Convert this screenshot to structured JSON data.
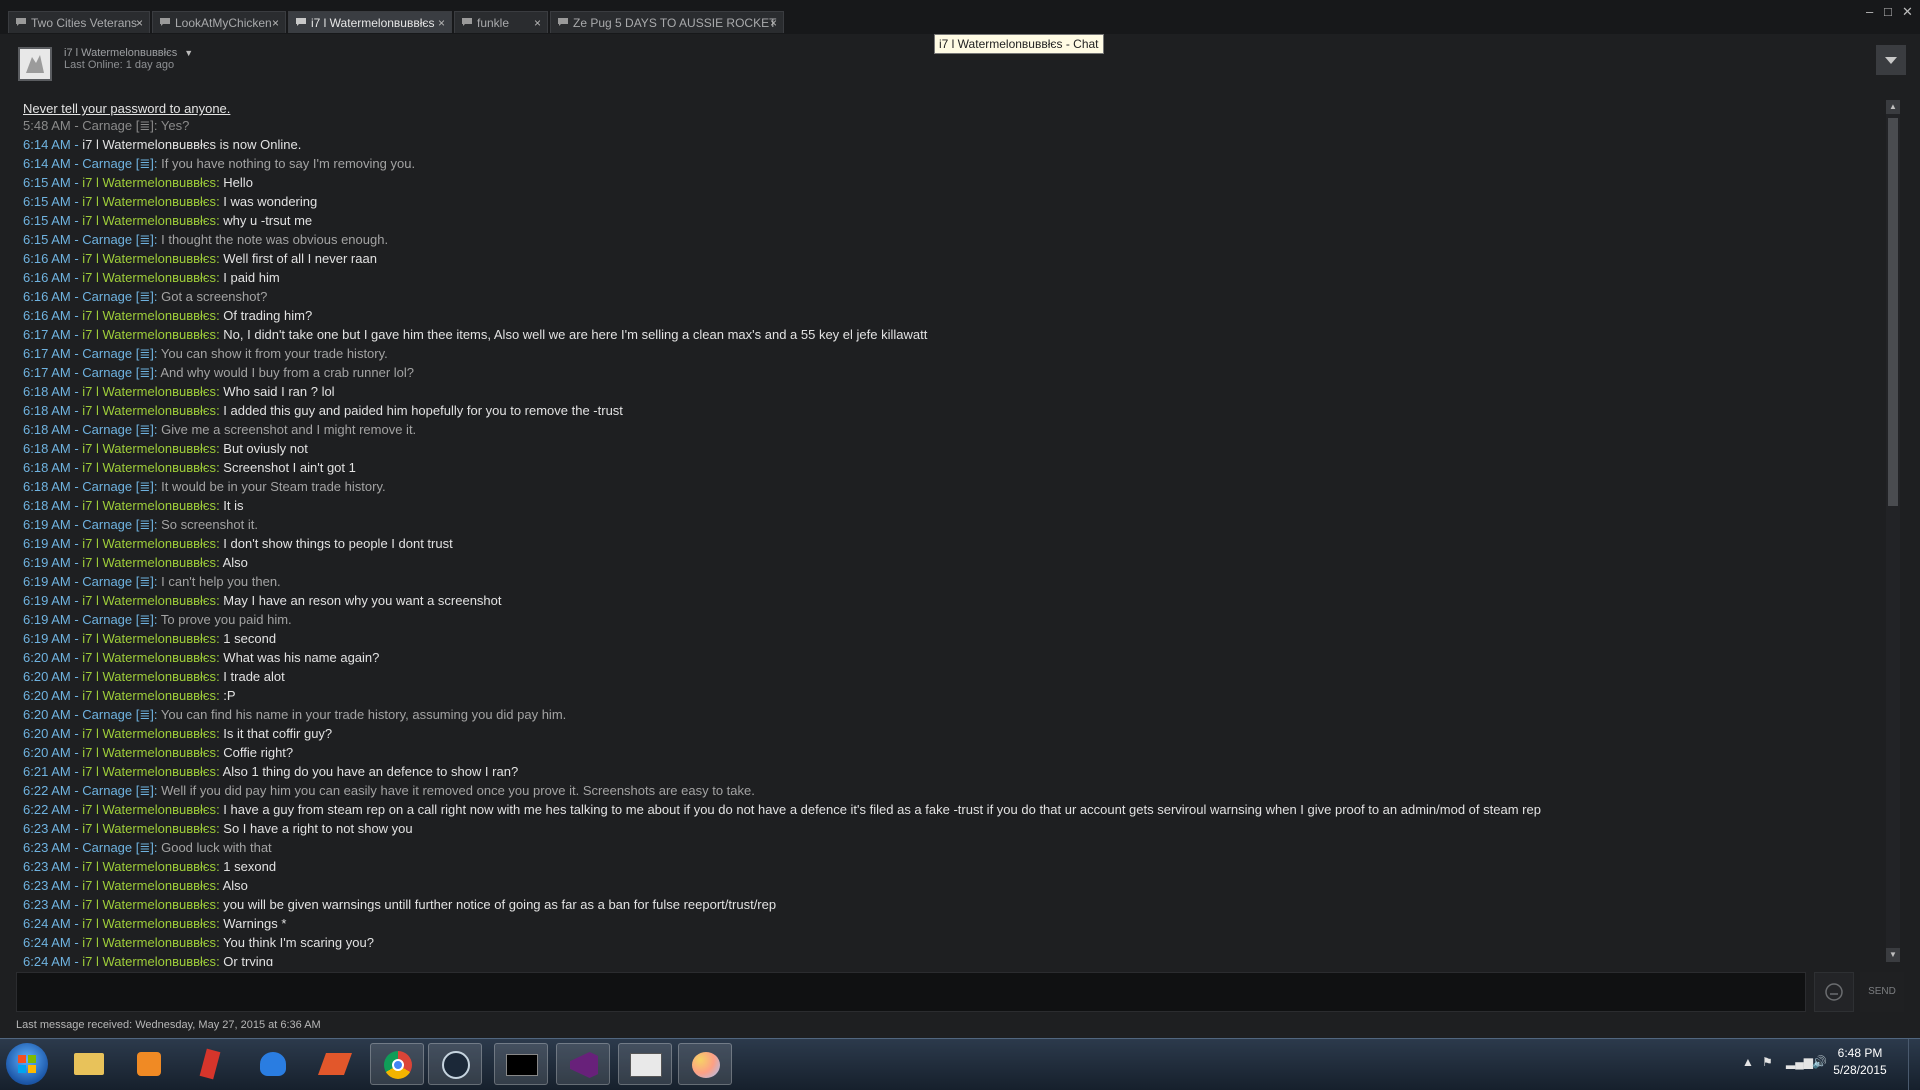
{
  "window": {
    "tabs": [
      {
        "label": "Two Cities Veterans"
      },
      {
        "label": "LookAtMyChicken"
      },
      {
        "label": "i7 l Watermelonвuввłєs"
      },
      {
        "label": "funkle"
      },
      {
        "label": "Ze Pug 5 DAYS TO AUSSIE ROCKET"
      }
    ],
    "tooltip": "i7 l Watermelonвuввłєs - Chat",
    "controls": {
      "minimize": "–",
      "maximize": "□",
      "close": "✕"
    }
  },
  "header": {
    "name": "i7 l Watermelonвuввłєs",
    "last_online": "Last Online: 1 day ago"
  },
  "chat": {
    "warning": "Never tell your password to anyone.",
    "messages": [
      {
        "time": "5:48 AM",
        "name": "Carnage [≣]",
        "msg": "Yes?",
        "who": "c",
        "old": true
      },
      {
        "time": "6:14 AM",
        "name": "",
        "msg": "i7 l Watermelonвuввłєs is now Online.",
        "who": "s"
      },
      {
        "time": "6:14 AM",
        "name": "Carnage [≣]",
        "msg": "If you have nothing to say I'm removing you.",
        "who": "c"
      },
      {
        "time": "6:15 AM",
        "name": "i7 l Watermelonвuввłєs",
        "msg": "Hello",
        "who": "w"
      },
      {
        "time": "6:15 AM",
        "name": "i7 l Watermelonвuввłєs",
        "msg": "I was wondering",
        "who": "w"
      },
      {
        "time": "6:15 AM",
        "name": "i7 l Watermelonвuввłєs",
        "msg": "why u -trsut me",
        "who": "w"
      },
      {
        "time": "6:15 AM",
        "name": "Carnage [≣]",
        "msg": "I thought the note was obvious enough.",
        "who": "c"
      },
      {
        "time": "6:16 AM",
        "name": "i7 l Watermelonвuввłєs",
        "msg": "Well first of all I never raan",
        "who": "w"
      },
      {
        "time": "6:16 AM",
        "name": "i7 l Watermelonвuввłєs",
        "msg": "I paid him",
        "who": "w"
      },
      {
        "time": "6:16 AM",
        "name": "Carnage [≣]",
        "msg": "Got a screenshot?",
        "who": "c"
      },
      {
        "time": "6:16 AM",
        "name": "i7 l Watermelonвuввłєs",
        "msg": "Of trading him?",
        "who": "w"
      },
      {
        "time": "6:17 AM",
        "name": "i7 l Watermelonвuввłєs",
        "msg": "No, I didn't take one but I gave him thee items, Also well we are here I'm selling a clean max's and a 55 key el jefe killawatt",
        "who": "w"
      },
      {
        "time": "6:17 AM",
        "name": "Carnage [≣]",
        "msg": "You can show it from your trade history.",
        "who": "c"
      },
      {
        "time": "6:17 AM",
        "name": "Carnage [≣]",
        "msg": "And why would I buy from a crab runner lol?",
        "who": "c"
      },
      {
        "time": "6:18 AM",
        "name": "i7 l Watermelonвuввłєs",
        "msg": "Who said I ran ? lol",
        "who": "w"
      },
      {
        "time": "6:18 AM",
        "name": "i7 l Watermelonвuввłєs",
        "msg": "I added this guy and paided him hopefully for you to remove the -trust",
        "who": "w"
      },
      {
        "time": "6:18 AM",
        "name": "Carnage [≣]",
        "msg": "Give me a screenshot and I might remove it.",
        "who": "c"
      },
      {
        "time": "6:18 AM",
        "name": "i7 l Watermelonвuввłєs",
        "msg": "But oviusly not",
        "who": "w"
      },
      {
        "time": "6:18 AM",
        "name": "i7 l Watermelonвuввłєs",
        "msg": "Screenshot I ain't got 1",
        "who": "w"
      },
      {
        "time": "6:18 AM",
        "name": "Carnage [≣]",
        "msg": "It would be in your Steam trade history.",
        "who": "c"
      },
      {
        "time": "6:18 AM",
        "name": "i7 l Watermelonвuввłєs",
        "msg": "It is",
        "who": "w"
      },
      {
        "time": "6:19 AM",
        "name": "Carnage [≣]",
        "msg": "So screenshot it.",
        "who": "c"
      },
      {
        "time": "6:19 AM",
        "name": "i7 l Watermelonвuввłєs",
        "msg": "I don't show things to people I dont trust",
        "who": "w"
      },
      {
        "time": "6:19 AM",
        "name": "i7 l Watermelonвuввłєs",
        "msg": "Also",
        "who": "w"
      },
      {
        "time": "6:19 AM",
        "name": "Carnage [≣]",
        "msg": "I can't help you then.",
        "who": "c"
      },
      {
        "time": "6:19 AM",
        "name": "i7 l Watermelonвuввłєs",
        "msg": "May I have an reson why  you want a screenshot",
        "who": "w"
      },
      {
        "time": "6:19 AM",
        "name": "Carnage [≣]",
        "msg": "To prove you paid him.",
        "who": "c"
      },
      {
        "time": "6:19 AM",
        "name": "i7 l Watermelonвuввłєs",
        "msg": "1 second",
        "who": "w"
      },
      {
        "time": "6:20 AM",
        "name": "i7 l Watermelonвuввłєs",
        "msg": "What was his name again?",
        "who": "w"
      },
      {
        "time": "6:20 AM",
        "name": "i7 l Watermelonвuввłєs",
        "msg": "I trade alot",
        "who": "w"
      },
      {
        "time": "6:20 AM",
        "name": "i7 l Watermelonвuввłєs",
        "msg": ":P",
        "who": "w"
      },
      {
        "time": "6:20 AM",
        "name": "Carnage [≣]",
        "msg": "You can find his name in your trade history, assuming you did pay him.",
        "who": "c"
      },
      {
        "time": "6:20 AM",
        "name": "i7 l Watermelonвuввłєs",
        "msg": "Is it that coffir guy?",
        "who": "w"
      },
      {
        "time": "6:20 AM",
        "name": "i7 l Watermelonвuввłєs",
        "msg": "Coffie right?",
        "who": "w"
      },
      {
        "time": "6:21 AM",
        "name": "i7 l Watermelonвuввłєs",
        "msg": "Also 1 thing do you have an defence to show I ran?",
        "who": "w"
      },
      {
        "time": "6:22 AM",
        "name": "Carnage [≣]",
        "msg": "Well if you did pay him you can easily have it removed once you prove it. Screenshots are easy to take.",
        "who": "c"
      },
      {
        "time": "6:22 AM",
        "name": "i7 l Watermelonвuввłєs",
        "msg": "I have a guy from steam rep on a call right now with me hes talking to me about if you do not have a defence it's filed as a fake -trust if you do that ur account gets serviroul warnsing when I give proof to an admin/mod of steam rep",
        "who": "w"
      },
      {
        "time": "6:23 AM",
        "name": "i7 l Watermelonвuввłєs",
        "msg": "So I have a right to not show you",
        "who": "w"
      },
      {
        "time": "6:23 AM",
        "name": "Carnage [≣]",
        "msg": "Good luck with that",
        "who": "c"
      },
      {
        "time": "6:23 AM",
        "name": "i7 l Watermelonвuввłєs",
        "msg": "1 sexond",
        "who": "w"
      },
      {
        "time": "6:23 AM",
        "name": "i7 l Watermelonвuввłєs",
        "msg": "Also",
        "who": "w"
      },
      {
        "time": "6:23 AM",
        "name": "i7 l Watermelonвuввłєs",
        "msg": "you will be given warnsings untill further notice of going as far as a ban for fulse reeport/trust/rep",
        "who": "w"
      },
      {
        "time": "6:24 AM",
        "name": "i7 l Watermelonвuввłєs",
        "msg": "Warnings *",
        "who": "w"
      },
      {
        "time": "6:24 AM",
        "name": "i7 l Watermelonвuввłєs",
        "msg": "You think I'm scaring you?",
        "who": "w"
      },
      {
        "time": "6:24 AM",
        "name": "i7 l Watermelonвuввłєs",
        "msg": "Or trying",
        "who": "w"
      }
    ]
  },
  "composer": {
    "send_label": "SEND",
    "last_message": "Last message received: Wednesday, May 27, 2015 at 6:36 AM"
  },
  "taskbar": {
    "apps": [
      "windows-explorer",
      "media-player",
      "app-red",
      "malwarebytes",
      "app-orange",
      "chrome",
      "steam",
      "cmd",
      "visual-studio",
      "app-window",
      "paint"
    ],
    "clock_time": "6:48 PM",
    "clock_date": "5/28/2015"
  }
}
